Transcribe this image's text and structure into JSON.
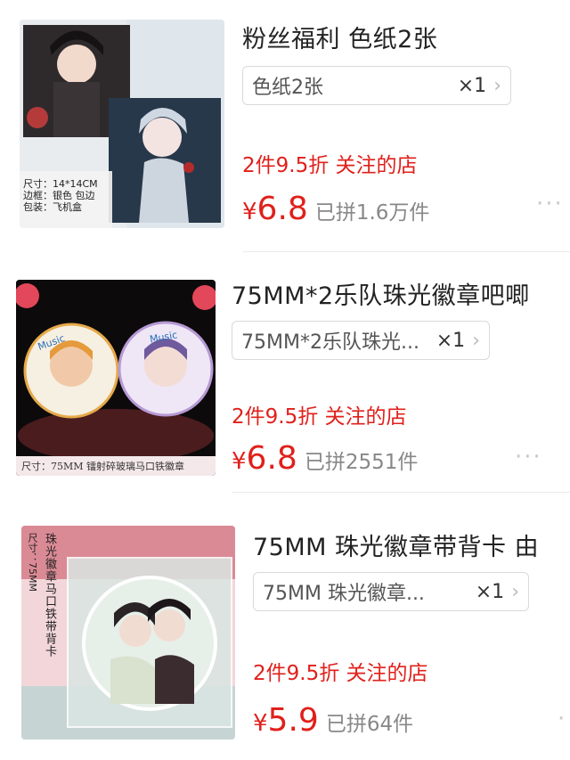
{
  "products": [
    {
      "title": "粉丝福利 色纸2张",
      "sku": "色纸2张",
      "qty": "×1",
      "promo": "2件9.5折 关注的店",
      "currency": "¥",
      "price": "6.8",
      "sold": "已拼1.6万件",
      "image_caption": [
        "尺寸：14*14CM",
        "边框：银色 包边",
        "包装：飞机盒"
      ]
    },
    {
      "title": "75MM*2乐队珠光徽章吧唧",
      "sku": "75MM*2乐队珠光...",
      "qty": "×1",
      "promo": "2件9.5折 关注的店",
      "currency": "¥",
      "price": "6.8",
      "sold": "已拼2551件",
      "image_caption": [
        "尺寸：75MM 镭射碎玻璃马口铁徽章"
      ],
      "badge_text": [
        "Music",
        "Music"
      ]
    },
    {
      "title": "75MM 珠光徽章带背卡 由",
      "sku": "75MM 珠光徽章...",
      "qty": "×1",
      "promo": "2件9.5折 关注的店",
      "currency": "¥",
      "price": "5.9",
      "sold": "已拼64件",
      "image_caption": [
        "尺寸：75MM",
        "珠光徽章马口铁带背卡"
      ]
    }
  ],
  "icons": {
    "chevron": "chevron-right-icon",
    "more": "more-dots-icon"
  },
  "colors": {
    "accent_red": "#e0201b",
    "muted_gray": "#888888"
  }
}
